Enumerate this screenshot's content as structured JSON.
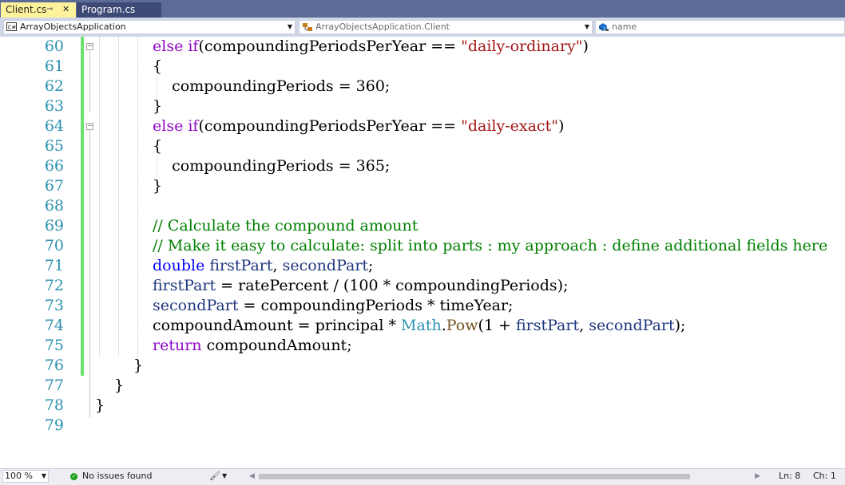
{
  "tabs": [
    {
      "label": "Client.cs",
      "pin": "⊸",
      "close": "✕",
      "active": true
    },
    {
      "label": "Program.cs",
      "active": false
    }
  ],
  "navbar": {
    "project": "ArrayObjectsApplication",
    "class_scope": "ArrayObjectsApplication.Client",
    "member": "name",
    "project_icon": "csharp-project-icon",
    "class_icon": "class-icon",
    "member_icon": "field-icon"
  },
  "editor": {
    "lines": [
      {
        "num": "60",
        "tokens": [
          [
            "kwc",
            "else if"
          ],
          [
            "",
            "(compoundingPeriodsPerYear == "
          ],
          [
            "str",
            "\"daily-ordinary\""
          ],
          [
            "",
            ")"
          ]
        ]
      },
      {
        "num": "61",
        "tokens": [
          [
            "",
            "{"
          ]
        ]
      },
      {
        "num": "62",
        "tokens": [
          [
            "",
            "    compoundingPeriods = 360;"
          ]
        ]
      },
      {
        "num": "63",
        "tokens": [
          [
            "",
            "}"
          ]
        ]
      },
      {
        "num": "64",
        "tokens": [
          [
            "kwc",
            "else if"
          ],
          [
            "",
            "(compoundingPeriodsPerYear == "
          ],
          [
            "str",
            "\"daily-exact\""
          ],
          [
            "",
            ")"
          ]
        ]
      },
      {
        "num": "65",
        "tokens": [
          [
            "",
            "{"
          ]
        ]
      },
      {
        "num": "66",
        "tokens": [
          [
            "",
            "    compoundingPeriods = 365;"
          ]
        ]
      },
      {
        "num": "67",
        "tokens": [
          [
            "",
            "}"
          ]
        ]
      },
      {
        "num": "68",
        "tokens": []
      },
      {
        "num": "69",
        "tokens": [
          [
            "cm",
            "// Calculate the compound amount"
          ]
        ]
      },
      {
        "num": "70",
        "tokens": [
          [
            "cm",
            "// Make it easy to calculate: split into parts : my approach : define additional fields here"
          ]
        ]
      },
      {
        "num": "71",
        "tokens": [
          [
            "kw",
            "double"
          ],
          [
            "",
            " "
          ],
          [
            "fld",
            "firstPart"
          ],
          [
            "",
            ", "
          ],
          [
            "fld",
            "secondPart"
          ],
          [
            "",
            ";"
          ]
        ]
      },
      {
        "num": "72",
        "tokens": [
          [
            "fld",
            "firstPart"
          ],
          [
            "",
            " = ratePercent / (100 * compoundingPeriods);"
          ]
        ]
      },
      {
        "num": "73",
        "tokens": [
          [
            "fld",
            "secondPart"
          ],
          [
            "",
            " = compoundingPeriods * timeYear;"
          ]
        ]
      },
      {
        "num": "74",
        "tokens": [
          [
            "",
            "compoundAmount = principal * "
          ],
          [
            "typ",
            "Math"
          ],
          [
            "",
            "."
          ],
          [
            "mth",
            "Pow"
          ],
          [
            "",
            "(1 + "
          ],
          [
            "fld",
            "firstPart"
          ],
          [
            "",
            ", "
          ],
          [
            "fld",
            "secondPart"
          ],
          [
            "",
            ");"
          ]
        ]
      },
      {
        "num": "75",
        "tokens": [
          [
            "kwc",
            "return"
          ],
          [
            "",
            " compoundAmount;"
          ]
        ]
      },
      {
        "num": "76",
        "tokens": [
          [
            "",
            "}"
          ]
        ]
      },
      {
        "num": "77",
        "tokens": [
          [
            "",
            "}"
          ]
        ]
      },
      {
        "num": "78",
        "tokens": [
          [
            "",
            "}"
          ]
        ]
      },
      {
        "num": "79",
        "tokens": []
      }
    ],
    "fold_marker": "−"
  },
  "statusbar": {
    "zoom": "100 %",
    "issues": "No issues found",
    "line": "Ln: 8",
    "col": "Ch: 1",
    "issues_icon": "check-circle-icon",
    "status_color": "#1ba11b"
  },
  "colors": {
    "tab_strip": "#5d6b99",
    "active_tab": "#fff29d",
    "line_number": "#2b91af",
    "keyword": "#0000ff",
    "control_keyword": "#8f08c4",
    "string": "#a31515",
    "comment": "#008000",
    "change_bar": "#6ce26c"
  }
}
